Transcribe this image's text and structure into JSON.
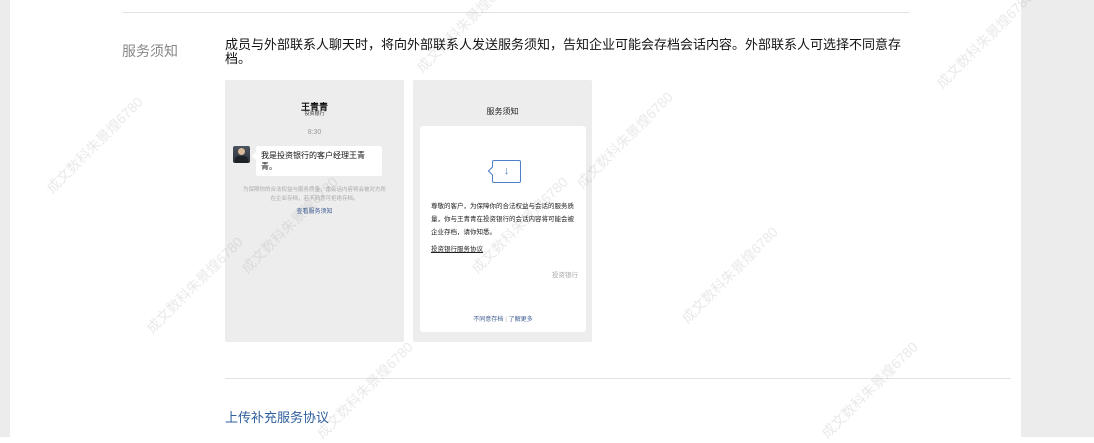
{
  "section": {
    "label": "服务须知",
    "description": "成员与外部联系人聊天时，将向外部联系人发送服务须知，告知企业可能会存档会话内容。外部联系人可选择不同意存档。"
  },
  "chat_preview": {
    "contact_name": "王青青",
    "company": "投资银行",
    "time": "8:30",
    "message": "我是投资银行的客户经理王青青。",
    "notice": "为保障你的合法权益与服务质量，本会话内容将会被对方所在企业存档，若不同意可拒绝存档。",
    "link": "查看服务须知"
  },
  "notice_preview": {
    "title": "服务须知",
    "icon": "download-document-icon",
    "body": "尊敬的客户，为保障你的合法权益与会话的服务质量，你与王青青在投资银行的会话内容将可能会被企业存档，请你知悉。",
    "agreement_link": "投资银行服务协议",
    "brand": "投资银行",
    "action_decline": "不同意存档",
    "action_separator": "|",
    "action_more": "了解更多"
  },
  "upload_link": "上传补充服务协议",
  "watermark": "成文数科朱景煌6780",
  "colors": {
    "link": "#2f5e9d",
    "panel_bg": "#ededed",
    "side_bg": "#ececec"
  }
}
